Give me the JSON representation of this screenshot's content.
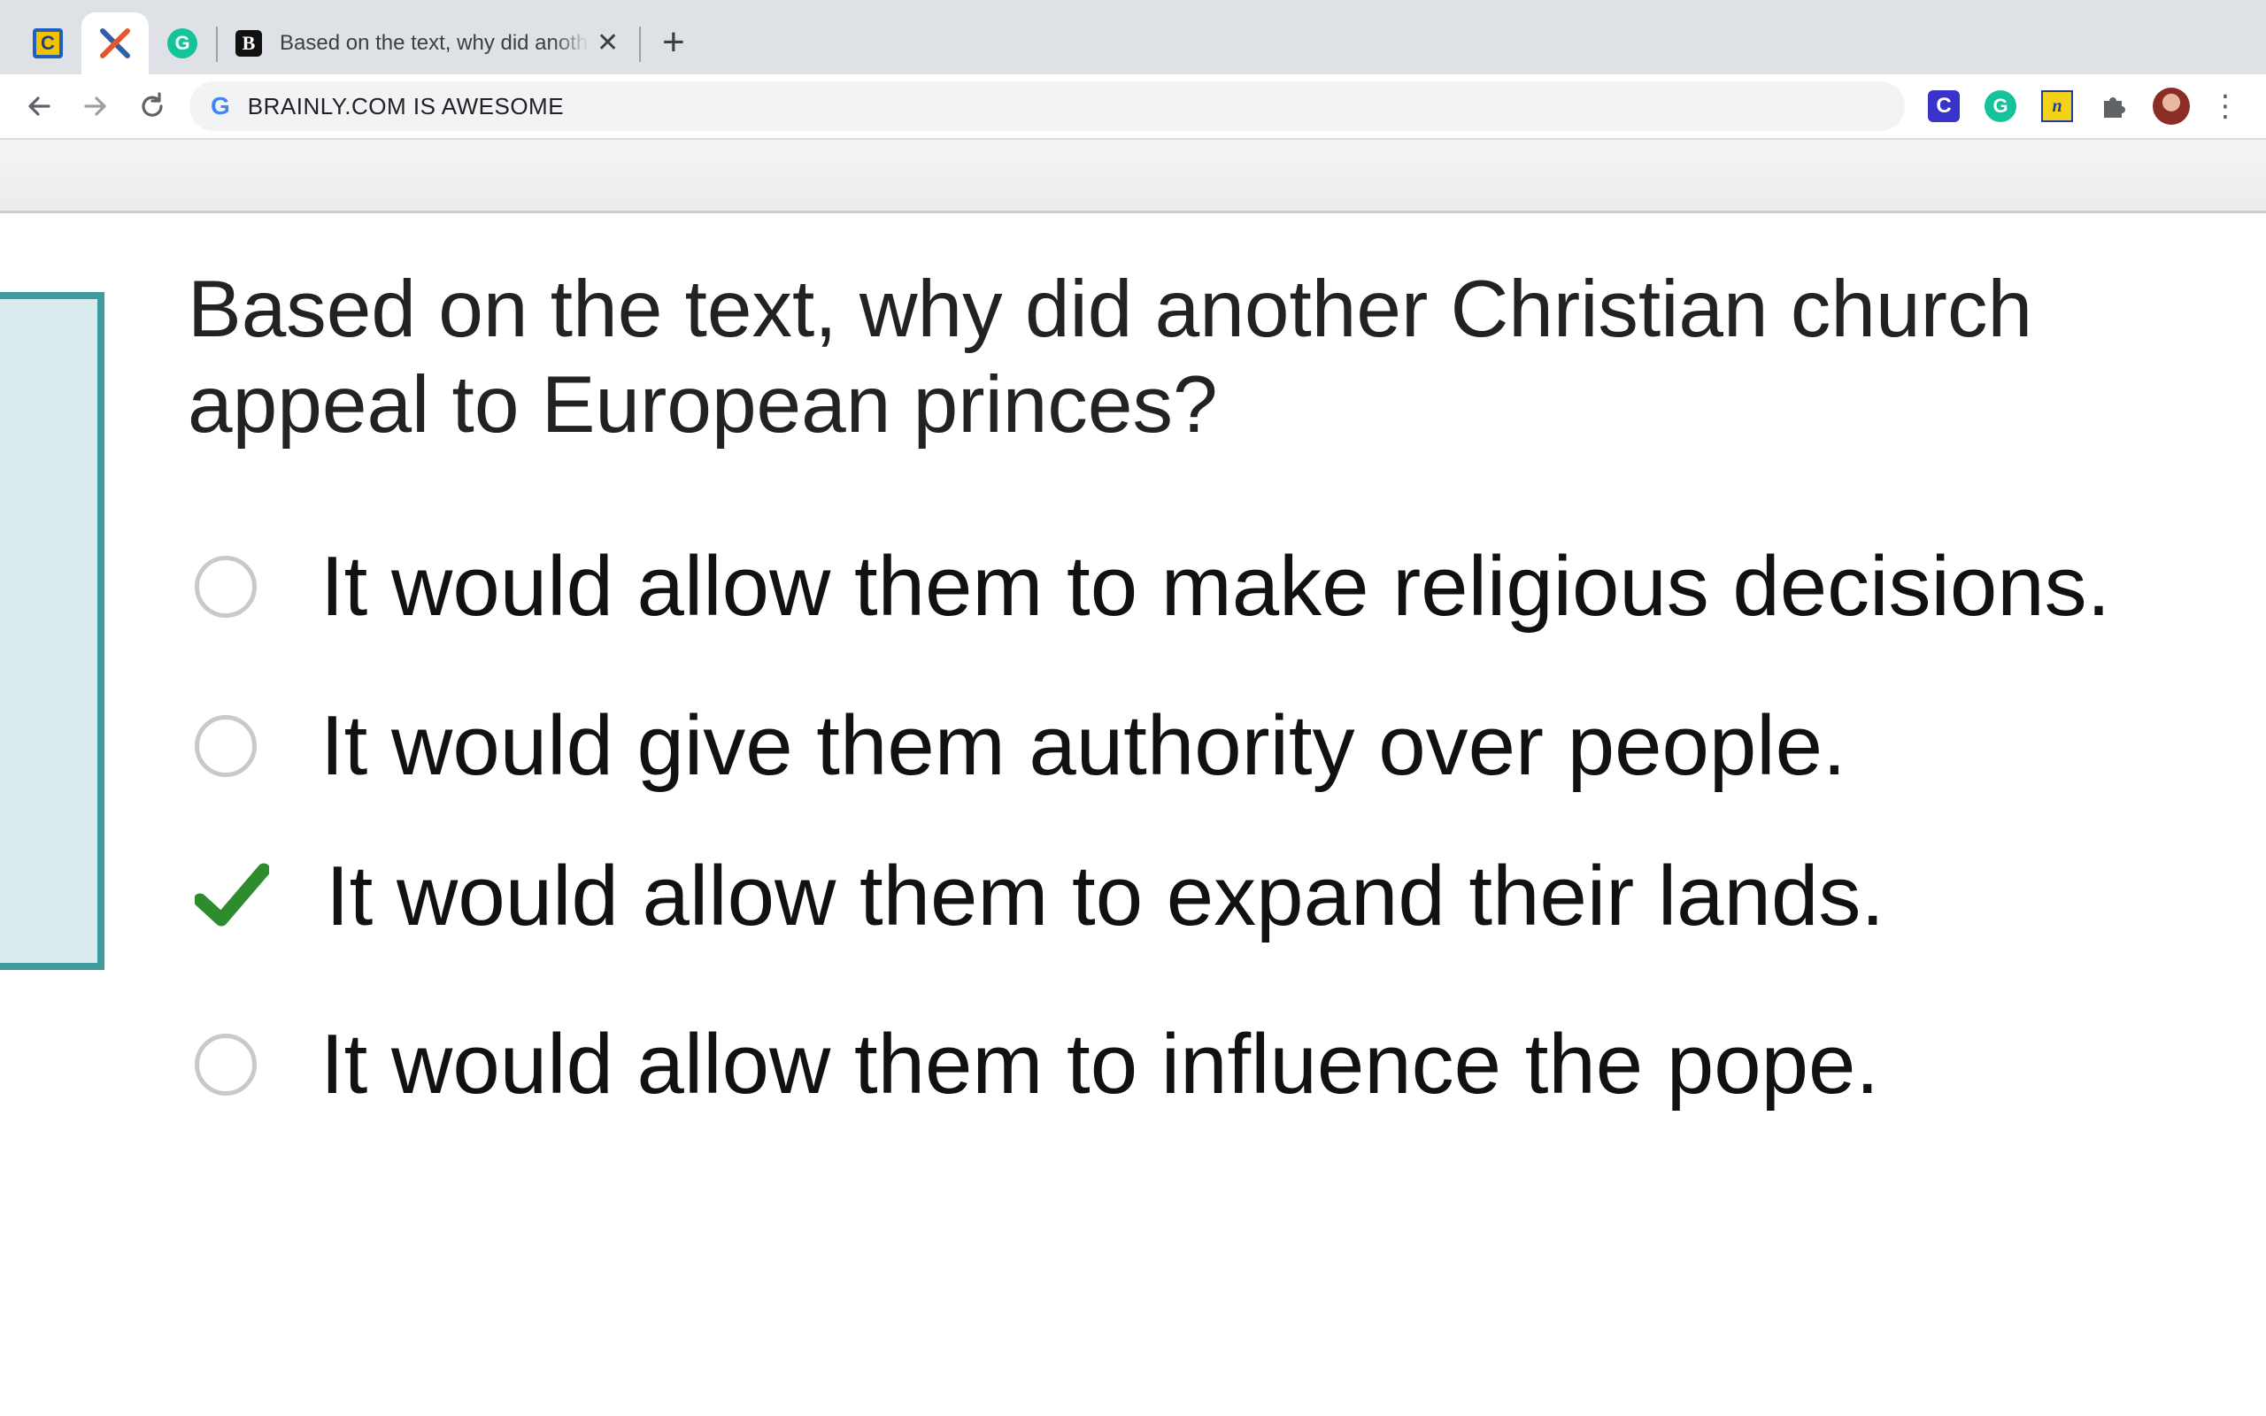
{
  "browser": {
    "active_tab_title": "Based on the text, why did another Christian church appeal to European princes?",
    "new_tab_label": "+",
    "close_label": "✕",
    "address_text": "BRAINLY.COM IS AWESOME",
    "google_g": "G",
    "favicon_c": "C",
    "favicon_g": "G",
    "favicon_b": "B",
    "ext_c": "C",
    "ext_g": "G",
    "ext_n": "n",
    "menu": "⋮"
  },
  "quiz": {
    "question": "Based on the text, why did another Christian church appeal to European princes?",
    "options": [
      {
        "label": "It would allow them to make religious decisions.",
        "state": "unselected"
      },
      {
        "label": "It would give them authority over people.",
        "state": "unselected"
      },
      {
        "label": "It would allow them to expand their lands.",
        "state": "selected-correct"
      },
      {
        "label": "It would allow them to influence the pope.",
        "state": "unselected"
      }
    ]
  },
  "colors": {
    "panel_border": "#3f9a9b",
    "panel_fill": "#d8ecef",
    "check_green": "#2e8b2e"
  }
}
